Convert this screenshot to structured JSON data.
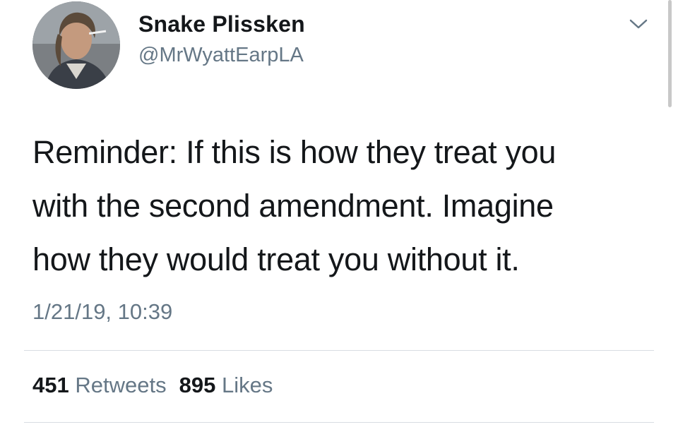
{
  "tweet": {
    "author": {
      "name": "Snake Plissken",
      "handle": "@MrWyattEarpLA",
      "avatar_icon": "profile-photo"
    },
    "menu_icon": "chevron-down-icon",
    "text_lines": [
      "Reminder: If this is how they treat you",
      "with the second amendment. Imagine",
      "how they would treat you without it."
    ],
    "timestamp": "1/21/19, 10:39",
    "stats": {
      "retweets_count": "451",
      "retweets_label": "Retweets",
      "likes_count": "895",
      "likes_label": "Likes"
    }
  },
  "colors": {
    "text": "#14171a",
    "secondary": "#657786",
    "divider": "#d8dde2"
  }
}
